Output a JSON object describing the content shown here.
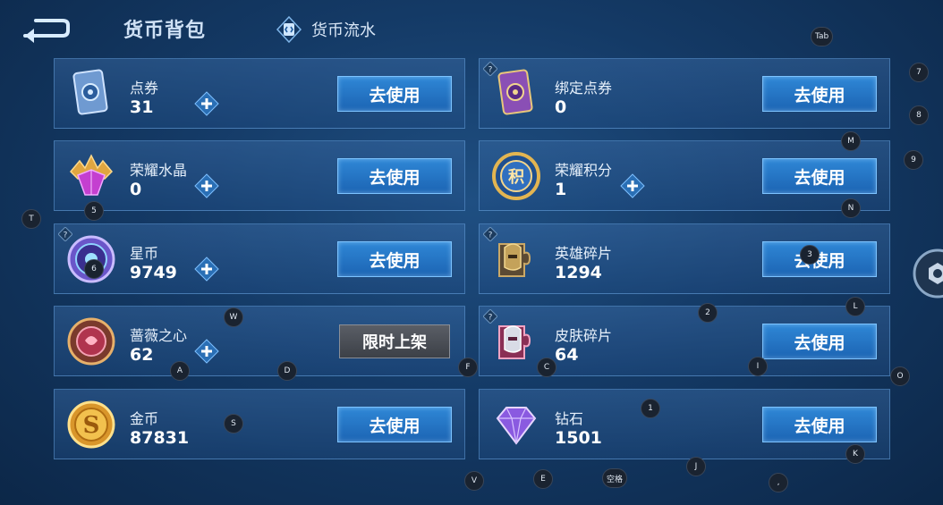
{
  "header": {
    "back_icon": "back-arrow-icon",
    "title": "货币背包",
    "flow_tab_label": "货币流水",
    "flow_tab_icon": "ledger-icon"
  },
  "button_label": "去使用",
  "limited_label": "限时上架",
  "currencies_left": [
    {
      "name": "点券",
      "value": "31",
      "icon": "coupon-card-icon",
      "has_plus": true,
      "has_help": false,
      "action": "use"
    },
    {
      "name": "荣耀水晶",
      "value": "0",
      "icon": "glory-crystal-icon",
      "has_plus": true,
      "has_help": false,
      "action": "use"
    },
    {
      "name": "星币",
      "value": "9749",
      "icon": "star-coin-icon",
      "has_plus": true,
      "has_help": true,
      "action": "use"
    },
    {
      "name": "蔷薇之心",
      "value": "62",
      "icon": "rose-heart-icon",
      "has_plus": true,
      "has_help": false,
      "action": "limited"
    },
    {
      "name": "金币",
      "value": "87831",
      "icon": "gold-coin-icon",
      "has_plus": false,
      "has_help": false,
      "action": "use"
    }
  ],
  "currencies_right": [
    {
      "name": "绑定点券",
      "value": "0",
      "icon": "bound-coupon-card-icon",
      "has_plus": false,
      "has_help": true,
      "action": "use"
    },
    {
      "name": "荣耀积分",
      "value": "1",
      "icon": "glory-points-icon",
      "has_plus": true,
      "has_help": false,
      "action": "use"
    },
    {
      "name": "英雄碎片",
      "value": "1294",
      "icon": "hero-fragment-icon",
      "has_plus": false,
      "has_help": true,
      "action": "use"
    },
    {
      "name": "皮肤碎片",
      "value": "64",
      "icon": "skin-fragment-icon",
      "has_plus": false,
      "has_help": true,
      "action": "use"
    },
    {
      "name": "钻石",
      "value": "1501",
      "icon": "diamond-icon",
      "has_plus": false,
      "has_help": false,
      "action": "use"
    }
  ],
  "key_hints": {
    "tab": "Tab",
    "k7": "7",
    "k8": "8",
    "k9": "9",
    "m": "M",
    "n": "N",
    "t": "T",
    "k5": "5",
    "k6": "6",
    "k3": "3",
    "w": "W",
    "k2": "2",
    "l": "L",
    "a": "A",
    "d": "D",
    "f": "F",
    "c": "C",
    "i": "I",
    "o": "O",
    "k1": "1",
    "s": "S",
    "j": "J",
    "k": "K",
    "v": "V",
    "e": "E",
    "space": "空格",
    "comma": ","
  },
  "colors": {
    "accent_button": "#1f6cbf",
    "limited_button": "#4a4e56",
    "card_border": "#6eaae6"
  }
}
